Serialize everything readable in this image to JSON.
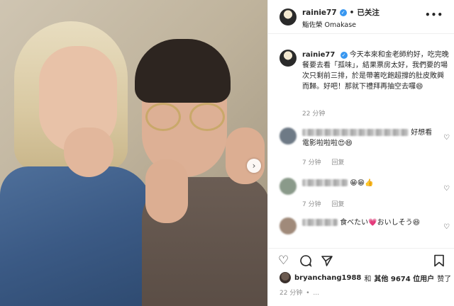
{
  "post": {
    "username": "rainie77",
    "follow_label": "已关注",
    "dot": "•",
    "location": "鮨佐榮 Omakase",
    "more_label": "•••"
  },
  "caption": {
    "username": "rainie77",
    "text": "今天本來和金老師約好，吃完晚餐要去看「孤味」，結果票房太好，我們要的場次只剩前三排，於是帶著吃飽超撐的肚皮敗興而歸。好吧！那就下禮拜再抽空去囉😄",
    "time": "22 分钟"
  },
  "comments": [
    {
      "text": "好想看電影啦啦啦😍😄",
      "time": "7 分钟",
      "reply": "回复"
    },
    {
      "text": "😁😁👍",
      "time": "7 分钟",
      "reply": "回复"
    },
    {
      "text": "食べたい💗おいしそう😆",
      "time": "",
      "reply": ""
    }
  ],
  "likes": {
    "user": "bryanchang1988",
    "and": "和",
    "others": "其他 9674 位用户",
    "suffix": "赞了"
  },
  "footer": {
    "time": "22 分钟",
    "sep": "•",
    "dismiss": "..."
  },
  "icons": {
    "like": "heart-icon",
    "comment": "comment-icon",
    "share": "share-icon",
    "save": "bookmark-icon",
    "next": "chevron-right-icon"
  }
}
